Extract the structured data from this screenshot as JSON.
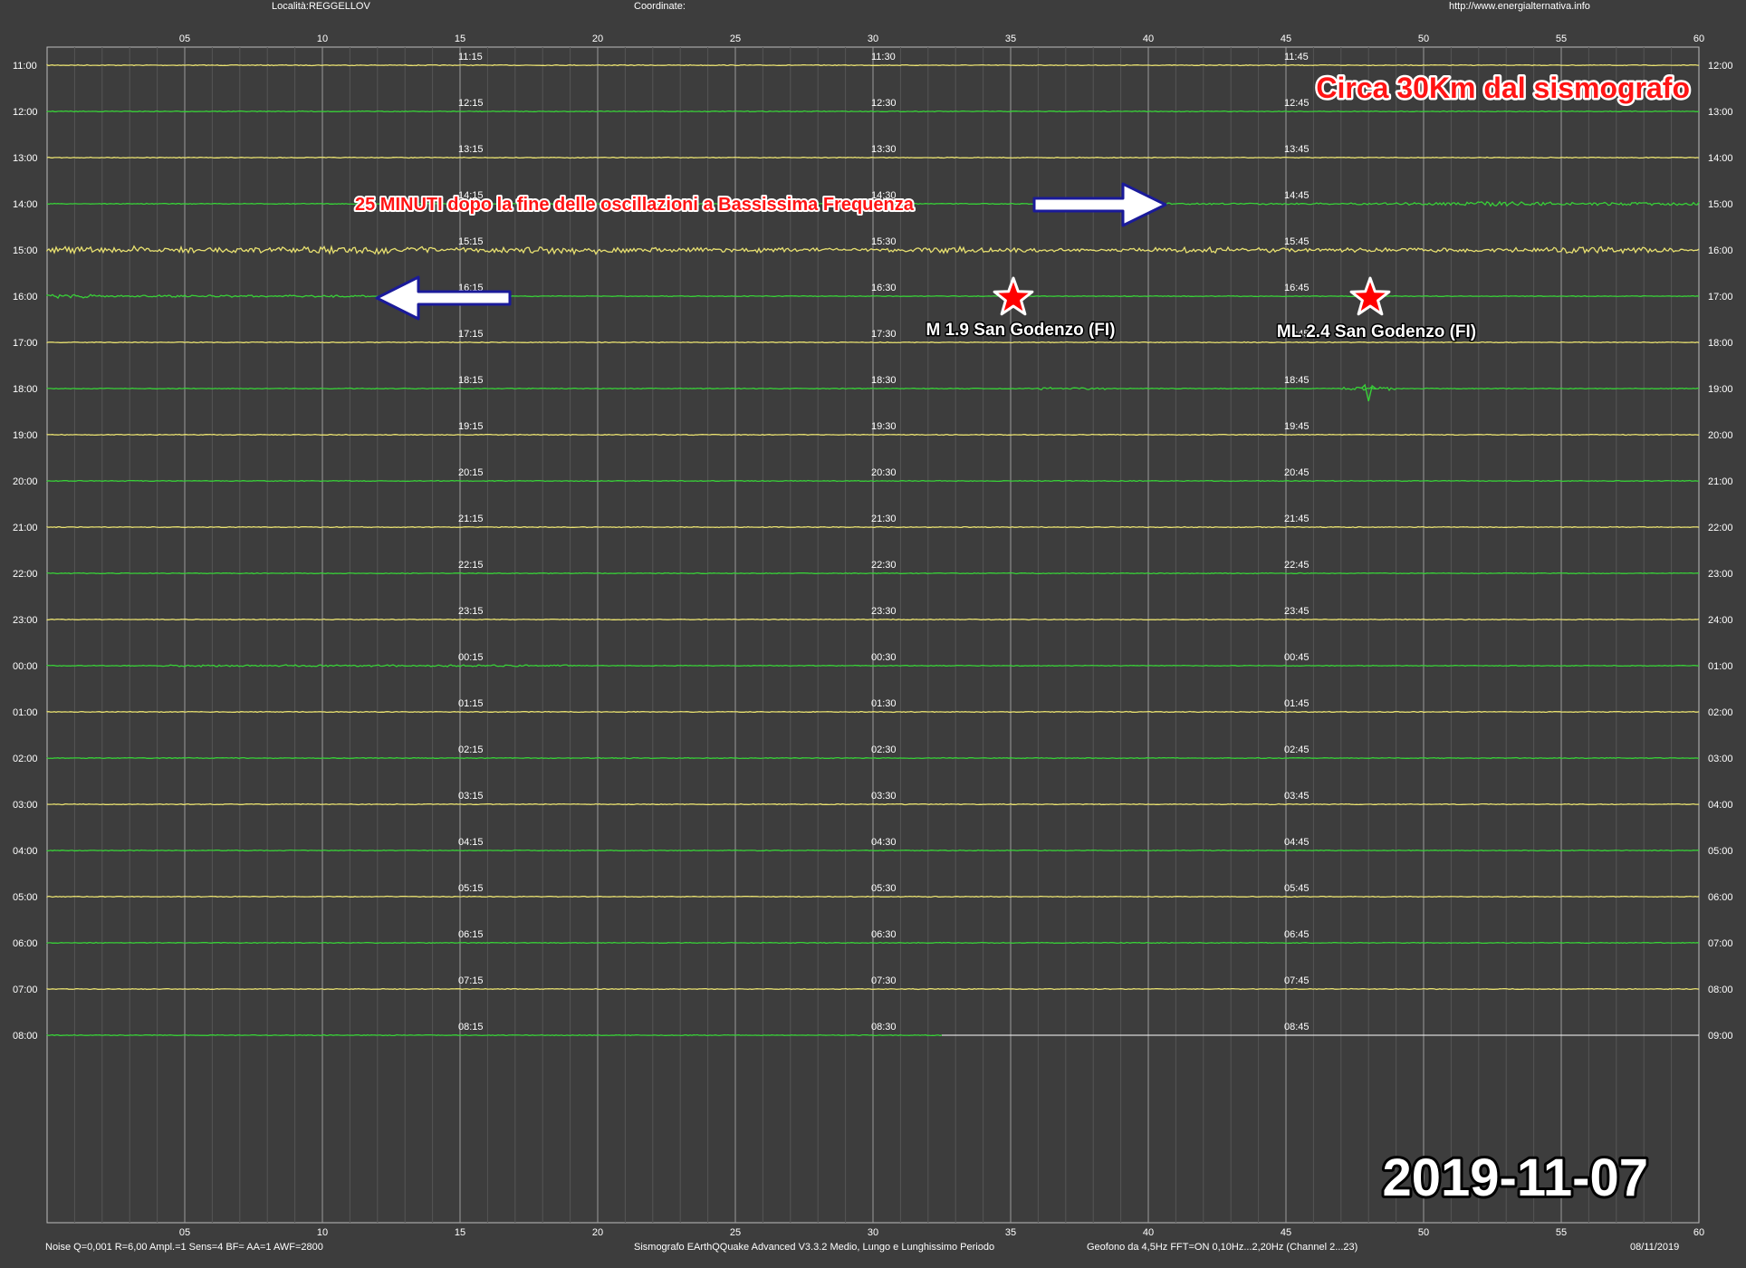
{
  "header": {
    "location": "Località:REGGELLOV",
    "coordinates": "Coordinate:",
    "url": "http://www.energialternativa.info"
  },
  "footer": {
    "settings": "Noise Q=0,001 R=6,00 Ampl.=1 Sens=4 BF= AA=1 AWF=2800",
    "software": "Sismografo  EArthQQuake Advanced V3.3.2  Medio, Lungo e Lunghissimo Periodo",
    "sensor": "Geofono da 4,5Hz FFT=ON 0,10Hz...2,20Hz      (Channel 2...23)",
    "date": "08/11/2019"
  },
  "minute_ticks": [
    "05",
    "10",
    "15",
    "20",
    "25",
    "30",
    "35",
    "40",
    "45",
    "50",
    "55",
    "60"
  ],
  "left_hours": [
    "11:00",
    "12:00",
    "13:00",
    "14:00",
    "15:00",
    "16:00",
    "17:00",
    "18:00",
    "19:00",
    "20:00",
    "21:00",
    "22:00",
    "23:00",
    "00:00",
    "01:00",
    "02:00",
    "03:00",
    "04:00",
    "05:00",
    "06:00",
    "07:00",
    "08:00"
  ],
  "right_hours": [
    "12:00",
    "13:00",
    "14:00",
    "15:00",
    "16:00",
    "17:00",
    "18:00",
    "19:00",
    "20:00",
    "21:00",
    "22:00",
    "23:00",
    "24:00",
    "01:00",
    "02:00",
    "03:00",
    "04:00",
    "05:00",
    "06:00",
    "07:00",
    "08:00",
    "09:00"
  ],
  "quarter_labels": [
    [
      "11:15",
      "11:30",
      "11:45"
    ],
    [
      "12:15",
      "12:30",
      "12:45"
    ],
    [
      "13:15",
      "13:30",
      "13:45"
    ],
    [
      "14:15",
      "14:30",
      "14:45"
    ],
    [
      "15:15",
      "15:30",
      "15:45"
    ],
    [
      "16:15",
      "16:30",
      "16:45"
    ],
    [
      "17:15",
      "17:30",
      "17:45"
    ],
    [
      "18:15",
      "18:30",
      "18:45"
    ],
    [
      "19:15",
      "19:30",
      "19:45"
    ],
    [
      "20:15",
      "20:30",
      "20:45"
    ],
    [
      "21:15",
      "21:30",
      "21:45"
    ],
    [
      "22:15",
      "22:30",
      "22:45"
    ],
    [
      "23:15",
      "23:30",
      "23:45"
    ],
    [
      "00:15",
      "00:30",
      "00:45"
    ],
    [
      "01:15",
      "01:30",
      "01:45"
    ],
    [
      "02:15",
      "02:30",
      "02:45"
    ],
    [
      "03:15",
      "03:30",
      "03:45"
    ],
    [
      "04:15",
      "04:30",
      "04:45"
    ],
    [
      "05:15",
      "05:30",
      "05:45"
    ],
    [
      "06:15",
      "06:30",
      "06:45"
    ],
    [
      "07:15",
      "07:30",
      "07:45"
    ],
    [
      "08:15",
      "08:30",
      "08:45"
    ]
  ],
  "annotations": {
    "distance": "Circa 30Km dal sismografo",
    "note": "25 MINUTI dopo la fine delle oscillazioni a Bassissima Frequenza",
    "event1": "M 1.9 San Godenzo (FI)",
    "event2": "ML 2.4 San Godenzo (FI)",
    "date": "2019-11-07"
  },
  "colors": {
    "background": "#3d3d3d",
    "trace_yellow": "#e8e070",
    "trace_green": "#38d038",
    "grid": "#7a7a7a",
    "annotation_red": "#ff1414",
    "arrow_blue": "#1a1a9a",
    "star": "#ff0000"
  }
}
